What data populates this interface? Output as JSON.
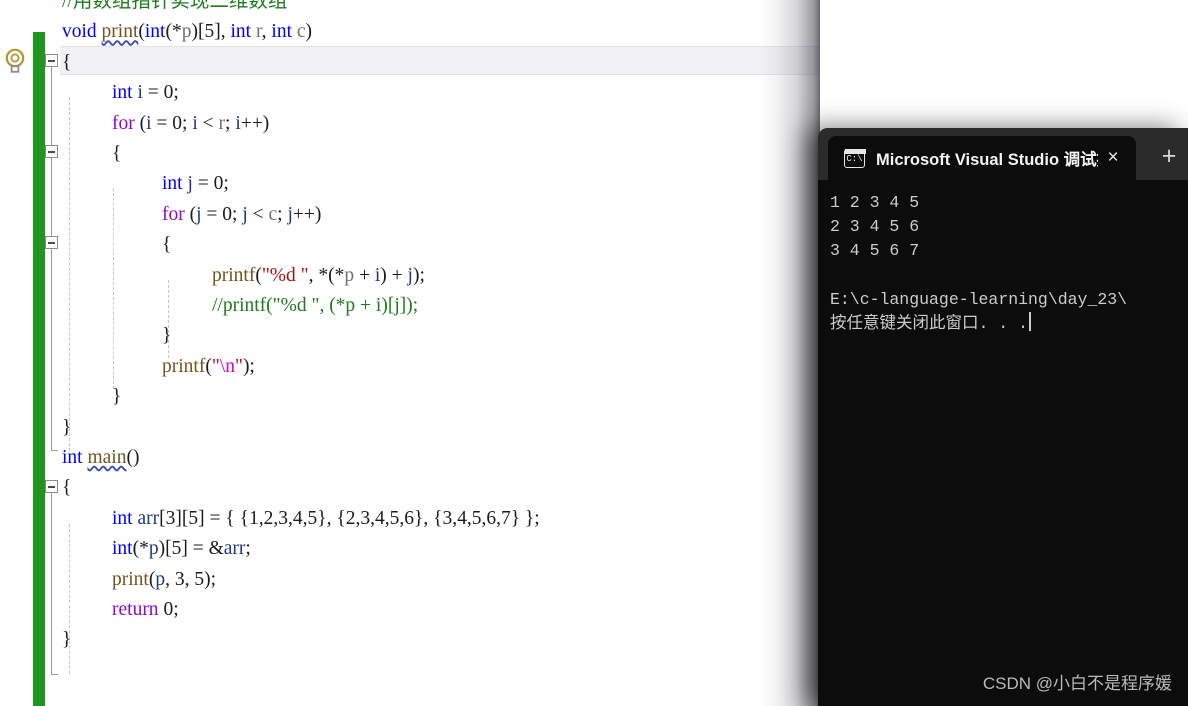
{
  "editor": {
    "name": "visual-studio-code-editor",
    "lightbulb_tooltip": "Quick Actions",
    "colors": {
      "change_bar_green": "#1f9620",
      "keyword_blue": "#0000ff",
      "control_purple": "#8f08c4",
      "function_brown": "#74531f",
      "string_red": "#a31515",
      "comment_green": "#1f7a1f",
      "escape_magenta": "#d300d3",
      "local_var_navy": "#1f377f",
      "param_gray": "#6f6f6f",
      "current_line_bg": "#f2f2f4"
    },
    "code_lines": [
      {
        "indent": 0,
        "fold": null,
        "tokens": [
          {
            "t": "//用数组指针实现二维数组",
            "c": "cmt"
          }
        ]
      },
      {
        "indent": 0,
        "fold": "box",
        "current": true,
        "tokens": [
          {
            "t": "void",
            "c": "kw"
          },
          {
            "t": " ",
            "c": "punct"
          },
          {
            "t": "print",
            "c": "fn squiggle"
          },
          {
            "t": "(",
            "c": "punct"
          },
          {
            "t": "int",
            "c": "kw"
          },
          {
            "t": "(*",
            "c": "punct"
          },
          {
            "t": "p",
            "c": "var"
          },
          {
            "t": ")[",
            "c": "punct"
          },
          {
            "t": "5",
            "c": "num"
          },
          {
            "t": "], ",
            "c": "punct"
          },
          {
            "t": "int",
            "c": "kw"
          },
          {
            "t": " ",
            "c": "punct"
          },
          {
            "t": "r",
            "c": "var"
          },
          {
            "t": ", ",
            "c": "punct"
          },
          {
            "t": "int",
            "c": "kw"
          },
          {
            "t": " ",
            "c": "punct"
          },
          {
            "t": "c",
            "c": "var"
          },
          {
            "t": ")",
            "c": "punct"
          }
        ]
      },
      {
        "indent": 0,
        "tokens": [
          {
            "t": "{",
            "c": "punct"
          }
        ]
      },
      {
        "indent": 1,
        "tokens": [
          {
            "t": "int",
            "c": "kw"
          },
          {
            "t": " ",
            "c": "punct"
          },
          {
            "t": "i",
            "c": "loc"
          },
          {
            "t": " = ",
            "c": "punct"
          },
          {
            "t": "0",
            "c": "num"
          },
          {
            "t": ";",
            "c": "punct"
          }
        ]
      },
      {
        "indent": 1,
        "fold": "box",
        "tokens": [
          {
            "t": "for",
            "c": "ctl"
          },
          {
            "t": " (",
            "c": "punct"
          },
          {
            "t": "i",
            "c": "loc"
          },
          {
            "t": " = ",
            "c": "punct"
          },
          {
            "t": "0",
            "c": "num"
          },
          {
            "t": "; ",
            "c": "punct"
          },
          {
            "t": "i",
            "c": "loc"
          },
          {
            "t": " < ",
            "c": "punct"
          },
          {
            "t": "r",
            "c": "var"
          },
          {
            "t": "; ",
            "c": "punct"
          },
          {
            "t": "i",
            "c": "loc"
          },
          {
            "t": "++)",
            "c": "punct"
          }
        ]
      },
      {
        "indent": 1,
        "tokens": [
          {
            "t": "{",
            "c": "punct"
          }
        ]
      },
      {
        "indent": 2,
        "tokens": [
          {
            "t": "int",
            "c": "kw"
          },
          {
            "t": " ",
            "c": "punct"
          },
          {
            "t": "j",
            "c": "loc"
          },
          {
            "t": " = ",
            "c": "punct"
          },
          {
            "t": "0",
            "c": "num"
          },
          {
            "t": ";",
            "c": "punct"
          }
        ]
      },
      {
        "indent": 2,
        "fold": "box",
        "tokens": [
          {
            "t": "for",
            "c": "ctl"
          },
          {
            "t": " (",
            "c": "punct"
          },
          {
            "t": "j",
            "c": "loc"
          },
          {
            "t": " = ",
            "c": "punct"
          },
          {
            "t": "0",
            "c": "num"
          },
          {
            "t": "; ",
            "c": "punct"
          },
          {
            "t": "j",
            "c": "loc"
          },
          {
            "t": " < ",
            "c": "punct"
          },
          {
            "t": "c",
            "c": "var"
          },
          {
            "t": "; ",
            "c": "punct"
          },
          {
            "t": "j",
            "c": "loc"
          },
          {
            "t": "++)",
            "c": "punct"
          }
        ]
      },
      {
        "indent": 2,
        "tokens": [
          {
            "t": "{",
            "c": "punct"
          }
        ]
      },
      {
        "indent": 3,
        "tokens": [
          {
            "t": "printf",
            "c": "fn"
          },
          {
            "t": "(",
            "c": "punct"
          },
          {
            "t": "\"%d \"",
            "c": "str"
          },
          {
            "t": ", *(*",
            "c": "punct"
          },
          {
            "t": "p",
            "c": "var"
          },
          {
            "t": " + ",
            "c": "punct"
          },
          {
            "t": "i",
            "c": "loc"
          },
          {
            "t": ") + ",
            "c": "punct"
          },
          {
            "t": "j",
            "c": "loc"
          },
          {
            "t": ");",
            "c": "punct"
          }
        ]
      },
      {
        "indent": 3,
        "tokens": [
          {
            "t": "//printf(\"%d \", (*p + i)[j]);",
            "c": "cmt"
          }
        ]
      },
      {
        "indent": 2,
        "tokens": [
          {
            "t": "}",
            "c": "punct"
          }
        ]
      },
      {
        "indent": 2,
        "tokens": [
          {
            "t": "printf",
            "c": "fn"
          },
          {
            "t": "(",
            "c": "punct"
          },
          {
            "t": "\"",
            "c": "str"
          },
          {
            "t": "\\n",
            "c": "esc"
          },
          {
            "t": "\"",
            "c": "str"
          },
          {
            "t": ");",
            "c": "punct"
          }
        ]
      },
      {
        "indent": 1,
        "tokens": [
          {
            "t": "}",
            "c": "punct"
          }
        ]
      },
      {
        "indent": 0,
        "tokens": [
          {
            "t": "}",
            "c": "punct"
          }
        ]
      },
      {
        "indent": 0,
        "fold": "box",
        "tokens": [
          {
            "t": "int",
            "c": "kw"
          },
          {
            "t": " ",
            "c": "punct"
          },
          {
            "t": "main",
            "c": "fn squiggle"
          },
          {
            "t": "()",
            "c": "punct"
          }
        ]
      },
      {
        "indent": 0,
        "tokens": [
          {
            "t": "{",
            "c": "punct"
          }
        ]
      },
      {
        "indent": 1,
        "tokens": [
          {
            "t": "int",
            "c": "kw"
          },
          {
            "t": " ",
            "c": "punct"
          },
          {
            "t": "arr",
            "c": "loc"
          },
          {
            "t": "[",
            "c": "punct"
          },
          {
            "t": "3",
            "c": "num"
          },
          {
            "t": "][",
            "c": "punct"
          },
          {
            "t": "5",
            "c": "num"
          },
          {
            "t": "] = { {",
            "c": "punct"
          },
          {
            "t": "1,2,3,4,5",
            "c": "num"
          },
          {
            "t": "}, {",
            "c": "punct"
          },
          {
            "t": "2,3,4,5,6",
            "c": "num"
          },
          {
            "t": "}, {",
            "c": "punct"
          },
          {
            "t": "3,4,5,6,7",
            "c": "num"
          },
          {
            "t": "} };",
            "c": "punct"
          }
        ]
      },
      {
        "indent": 1,
        "tokens": [
          {
            "t": "int",
            "c": "kw"
          },
          {
            "t": "(*",
            "c": "punct"
          },
          {
            "t": "p",
            "c": "loc"
          },
          {
            "t": ")[",
            "c": "punct"
          },
          {
            "t": "5",
            "c": "num"
          },
          {
            "t": "] = &",
            "c": "punct"
          },
          {
            "t": "arr",
            "c": "loc"
          },
          {
            "t": ";",
            "c": "punct"
          }
        ]
      },
      {
        "indent": 1,
        "tokens": [
          {
            "t": "print",
            "c": "fn"
          },
          {
            "t": "(",
            "c": "punct"
          },
          {
            "t": "p",
            "c": "loc"
          },
          {
            "t": ", ",
            "c": "punct"
          },
          {
            "t": "3",
            "c": "num"
          },
          {
            "t": ", ",
            "c": "punct"
          },
          {
            "t": "5",
            "c": "num"
          },
          {
            "t": ");",
            "c": "punct"
          }
        ]
      },
      {
        "indent": 1,
        "tokens": [
          {
            "t": "return",
            "c": "ctl"
          },
          {
            "t": " ",
            "c": "punct"
          },
          {
            "t": "0",
            "c": "num"
          },
          {
            "t": ";",
            "c": "punct"
          }
        ]
      },
      {
        "indent": 0,
        "tokens": [
          {
            "t": "}",
            "c": "punct"
          }
        ]
      }
    ]
  },
  "console": {
    "tab": {
      "icon": "terminal-icon",
      "icon_glyph": "C:\\",
      "title": "Microsoft Visual Studio 调试控",
      "close_label": "×"
    },
    "new_tab_label": "+",
    "output_lines": [
      "1 2 3 4 5",
      "2 3 4 5 6",
      "3 4 5 6 7",
      "",
      "E:\\c-language-learning\\day_23\\",
      "按任意键关闭此窗口. . ."
    ],
    "watermark": "CSDN @小白不是程序媛"
  }
}
